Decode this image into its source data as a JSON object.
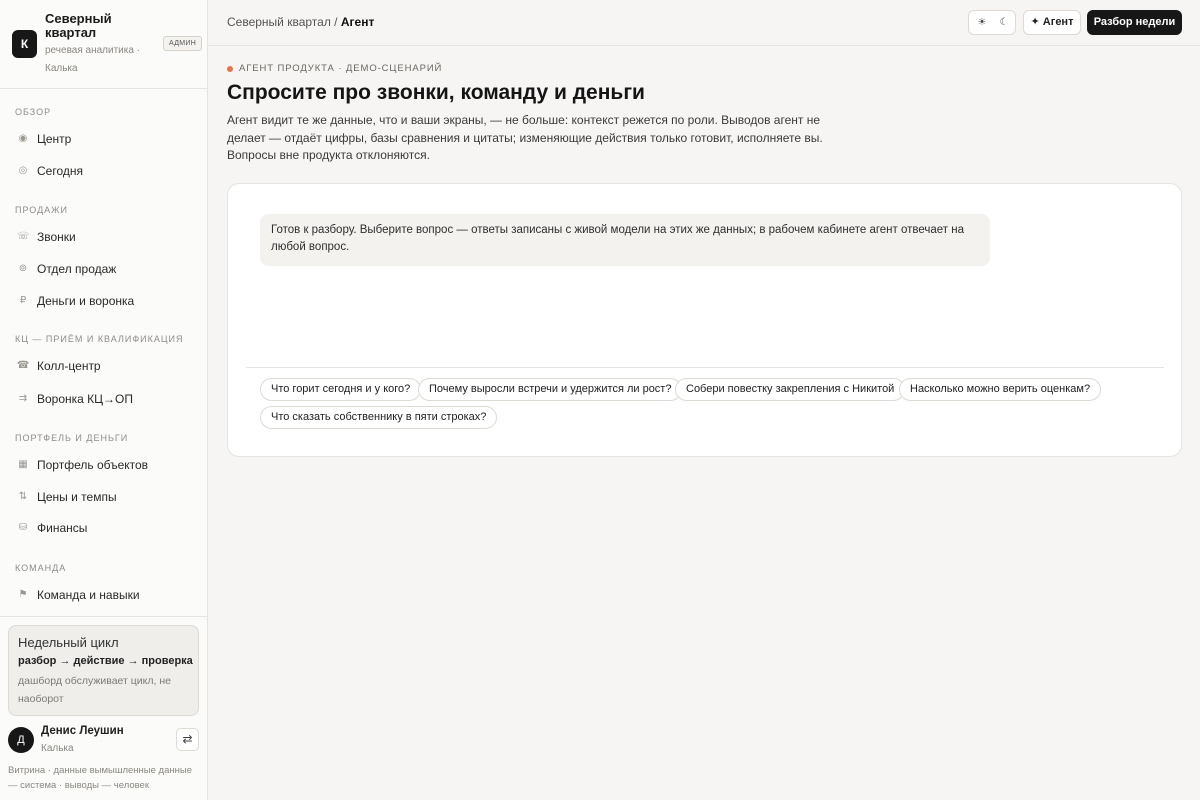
{
  "brand": {
    "logo_letter": "К",
    "name": "Северный квартал",
    "subtitle": "речевая аналитика · Калька",
    "admin_badge": "АДМИН"
  },
  "nav": {
    "sections": [
      {
        "title": "ОБЗОР",
        "items": [
          {
            "label": "Центр",
            "icon": "radio-dot-icon"
          },
          {
            "label": "Сегодня",
            "icon": "circle-icon"
          }
        ]
      },
      {
        "title": "ПРОДАЖИ",
        "items": [
          {
            "label": "Звонки",
            "icon": "phone-icon"
          },
          {
            "label": "Отдел продаж",
            "icon": "target-icon"
          },
          {
            "label": "Деньги и воронка",
            "icon": "ruble-icon"
          }
        ]
      },
      {
        "title": "КЦ — ПРИЁМ И КВАЛИФИКАЦИЯ",
        "items": [
          {
            "label": "Колл-центр",
            "icon": "telephone-icon"
          },
          {
            "label": "Воронка КЦ→ОП",
            "icon": "funnel-arrows-icon"
          }
        ]
      },
      {
        "title": "ПОРТФЕЛЬ И ДЕНЬГИ",
        "items": [
          {
            "label": "Портфель объектов",
            "icon": "grid-icon"
          },
          {
            "label": "Цены и темпы",
            "icon": "up-down-arrows-icon"
          },
          {
            "label": "Финансы",
            "icon": "coins-icon"
          }
        ]
      },
      {
        "title": "КОМАНДА",
        "items": [
          {
            "label": "Команда и навыки",
            "icon": "flag-icon"
          }
        ]
      }
    ]
  },
  "cycle": {
    "title": "Недельный цикл",
    "steps": "разбор → действие → проверка",
    "note": "дашборд обслуживает цикл, не наоборот"
  },
  "user": {
    "initial": "Д",
    "name": "Денис Леушин",
    "role": "Калька",
    "switch_symbol": "⇄"
  },
  "footnote": "Витрина · данные вымышленные данные — система · выводы — человек",
  "topbar": {
    "breadcrumb_root": "Северный квартал",
    "breadcrumb_sep": "/",
    "breadcrumb_current": "Агент",
    "theme_light_symbol": "☀",
    "theme_dark_symbol": "☾",
    "agent_label": "✦ Агент",
    "review_label": "Разбор недели"
  },
  "main": {
    "eyebrow": "АГЕНТ ПРОДУКТА · ДЕМО-СЦЕНАРИЙ",
    "title": "Спросите про звонки, команду и деньги",
    "description": "Агент видит те же данные, что и ваши экраны, — не больше: контекст режется по роли. Выводов агент не делает — отдаёт цифры, базы сравнения и цитаты; изменяющие действия только готовит, исполняете вы. Вопросы вне продукта отклоняются.",
    "accent_color": "#e8744a"
  },
  "chat": {
    "assistant_message": "Готов к разбору. Выберите вопрос — ответы записаны с живой модели на этих же данных; в рабочем кабинете агент отвечает на любой вопрос.",
    "suggestions": [
      "Что горит сегодня и у кого?",
      "Почему выросли встречи и удержится ли рост?",
      "Собери повестку закрепления с Никитой",
      "Насколько можно верить оценкам?",
      "Что сказать собственнику в пяти строках?"
    ]
  }
}
